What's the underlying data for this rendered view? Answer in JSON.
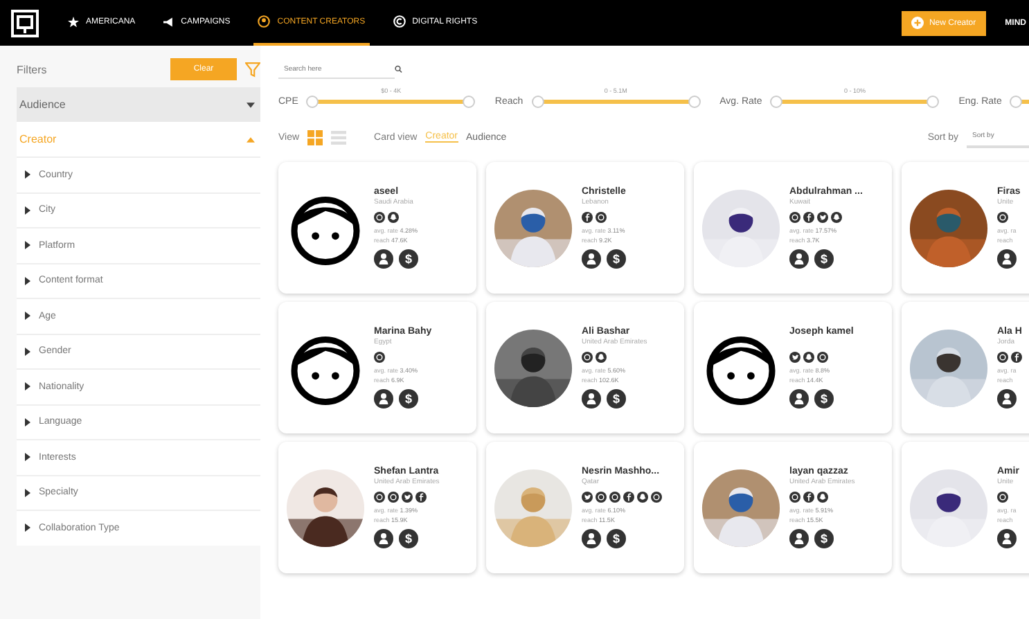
{
  "nav": {
    "tabs": [
      {
        "label": "AMERICANA",
        "kind": "star",
        "selected": false
      },
      {
        "label": "CAMPAIGNS",
        "kind": "megaphone",
        "selected": false
      },
      {
        "label": "CONTENT CREATORS",
        "kind": "person",
        "selected": true
      },
      {
        "label": "DIGITAL RIGHTS",
        "kind": "copyright",
        "selected": false
      }
    ],
    "action_button": "New Creator",
    "user": "MIND"
  },
  "filters": {
    "title": "Filters",
    "clear_button": "Clear",
    "sections": [
      {
        "label": "Audience",
        "expanded": false
      },
      {
        "label": "Creator",
        "expanded": true
      }
    ],
    "items": [
      "Country",
      "City",
      "Platform",
      "Content format",
      "Age",
      "Gender",
      "Nationality",
      "Language",
      "Interests",
      "Specialty",
      "Collaboration Type"
    ]
  },
  "search": {
    "placeholder": "Search here"
  },
  "sliders": [
    {
      "label": "CPE",
      "range": "$0 - 4K",
      "level": 1
    },
    {
      "label": "Reach",
      "range": "0 - 5.1M",
      "level": 1
    },
    {
      "label": "Avg. Rate",
      "range": "0 - 10%",
      "level": 1
    },
    {
      "label": "Eng. Rate",
      "level": 1
    }
  ],
  "view": {
    "label": "View",
    "modes": [
      {
        "kind": "grid",
        "selected": true
      },
      {
        "kind": "list",
        "selected": false
      }
    ],
    "card_view_label": "Card view",
    "card_views": [
      {
        "label": "Creator",
        "selected": true
      },
      {
        "label": "Audience",
        "selected": false
      }
    ],
    "sort_label": "Sort by",
    "sort_placeholder": "Sort by"
  },
  "creators": [
    {
      "name": "aseel",
      "country": "Saudi Arabia",
      "kind": "avatar",
      "socials": [
        {
          "kind": "web"
        },
        {
          "kind": "snap"
        }
      ],
      "stats": [
        {
          "label": "avg. rate",
          "value": "4.28%"
        },
        {
          "label": "reach",
          "value": "47.6K"
        }
      ],
      "currency": "$"
    },
    {
      "name": "Christelle",
      "country": "Lebanon",
      "kind": "picture",
      "socials": [
        {
          "kind": "facebook"
        },
        {
          "kind": "web"
        }
      ],
      "stats": [
        {
          "label": "avg. rate",
          "value": "3.11%"
        },
        {
          "label": "reach",
          "value": "9.2K"
        }
      ],
      "currency": "$"
    },
    {
      "name": "Abdulrahman ...",
      "country": "Kuwait",
      "kind": "picture",
      "socials": [
        {
          "kind": "web"
        },
        {
          "kind": "facebook"
        },
        {
          "kind": "twitter"
        },
        {
          "kind": "snap"
        }
      ],
      "stats": [
        {
          "label": "avg. rate",
          "value": "17.57%"
        },
        {
          "label": "reach",
          "value": "3.7K"
        }
      ],
      "currency": "$"
    },
    {
      "name": "Firas",
      "country": "Unite",
      "kind": "picture",
      "socials": [
        {
          "kind": "web"
        }
      ],
      "stats": [
        {
          "label": "avg. ra"
        },
        {
          "label": "reach"
        }
      ]
    },
    {
      "name": "Marina Bahy",
      "country": "Egypt",
      "kind": "avatar",
      "socials": [
        {
          "kind": "web"
        }
      ],
      "stats": [
        {
          "label": "avg. rate",
          "value": "3.40%"
        },
        {
          "label": "reach",
          "value": "6.9K"
        }
      ],
      "currency": "$"
    },
    {
      "name": "Ali Bashar",
      "country": "United Arab Emirates",
      "kind": "picture",
      "socials": [
        {
          "kind": "web"
        },
        {
          "kind": "snap"
        }
      ],
      "stats": [
        {
          "label": "avg. rate",
          "value": "5.60%"
        },
        {
          "label": "reach",
          "value": "102.6K"
        }
      ],
      "currency": "$"
    },
    {
      "name": "Joseph kamel",
      "kind": "avatar",
      "socials": [
        {
          "kind": "twitter"
        },
        {
          "kind": "snap"
        },
        {
          "kind": "web"
        }
      ],
      "stats": [
        {
          "label": "avg. rate",
          "value": "8.8%"
        },
        {
          "label": "reach",
          "value": "14.4K"
        }
      ],
      "currency": "$"
    },
    {
      "name": "Ala H",
      "country": "Jorda",
      "kind": "picture",
      "socials": [
        {
          "kind": "web"
        },
        {
          "kind": "facebook"
        }
      ],
      "stats": [
        {
          "label": "avg. ra"
        },
        {
          "label": "reach"
        }
      ]
    },
    {
      "name": "Shefan Lantra",
      "country": "United Arab Emirates",
      "kind": "picture",
      "socials": [
        {
          "kind": "web"
        },
        {
          "kind": "web"
        },
        {
          "kind": "twitter"
        },
        {
          "kind": "facebook"
        }
      ],
      "stats": [
        {
          "label": "avg. rate",
          "value": "1.39%"
        },
        {
          "label": "reach",
          "value": "15.9K"
        }
      ],
      "currency": "$"
    },
    {
      "name": "Nesrin Mashho...",
      "country": "Qatar",
      "kind": "picture",
      "socials": [
        {
          "kind": "twitter"
        },
        {
          "kind": "web"
        },
        {
          "kind": "web"
        },
        {
          "kind": "facebook"
        },
        {
          "kind": "snap"
        },
        {
          "kind": "web"
        }
      ],
      "stats": [
        {
          "label": "avg. rate",
          "value": "6.10%"
        },
        {
          "label": "reach",
          "value": "11.5K"
        }
      ],
      "currency": "$"
    },
    {
      "name": "layan qazzaz",
      "country": "United Arab Emirates",
      "kind": "picture",
      "socials": [
        {
          "kind": "web"
        },
        {
          "kind": "facebook"
        },
        {
          "kind": "snap"
        }
      ],
      "stats": [
        {
          "label": "avg. rate",
          "value": "5.91%"
        },
        {
          "label": "reach",
          "value": "15.5K"
        }
      ],
      "currency": "$"
    },
    {
      "name": "Amir",
      "country": "Unite",
      "kind": "picture",
      "socials": [
        {
          "kind": "web"
        }
      ],
      "stats": [
        {
          "label": "avg. ra"
        },
        {
          "label": "reach"
        }
      ]
    }
  ]
}
